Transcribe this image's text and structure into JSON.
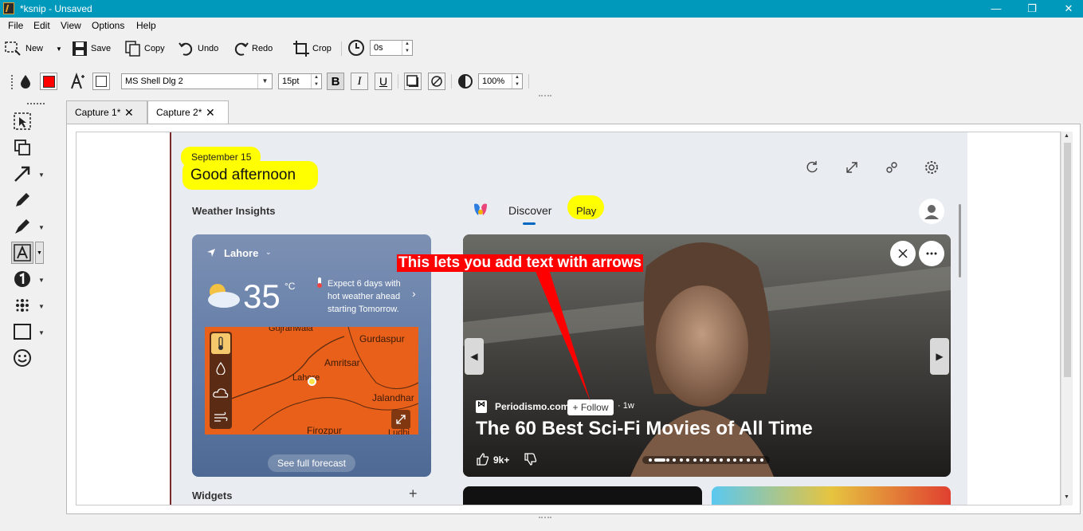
{
  "window": {
    "title": "*ksnip - Unsaved",
    "minimize": "—",
    "maximize": "❐",
    "close": "✕",
    "accent": "#0099bc"
  },
  "menu": [
    "File",
    "Edit",
    "View",
    "Options",
    "Help"
  ],
  "toolbar": {
    "new": "New",
    "save": "Save",
    "copy": "Copy",
    "undo": "Undo",
    "redo": "Redo",
    "crop": "Crop",
    "delay": "0s"
  },
  "format_bar": {
    "color": "#ff0000",
    "font": "MS Shell Dlg 2",
    "size": "15pt",
    "bold": "B",
    "italic": "I",
    "underline": "U",
    "opacity": "100%"
  },
  "tabs": [
    "Capture 1*",
    "Capture 2*"
  ],
  "tab_close": "✕",
  "widget": {
    "date": "September 15",
    "greeting": "Good afternoon",
    "weather_title": "Weather Insights",
    "tab_discover": "Discover",
    "tab_play": "Play",
    "city": "Lahore",
    "temp": "35",
    "unit": "°C",
    "forecast_note": [
      "Expect 6 days with",
      "hot weather ahead",
      "starting Tomorrow."
    ],
    "map_labels": [
      "Gujranwala",
      "Gurdaspur",
      "Amritsar",
      "Lahore",
      "Jalandhar",
      "Firozpur",
      "Ludhi"
    ],
    "see_forecast": "See full forecast",
    "widgets_label": "Widgets",
    "add": "+"
  },
  "article": {
    "source": "Periodismo.com",
    "follow": "+ Follow",
    "age": "· 1w",
    "headline": "The 60 Best Sci-Fi Movies of All Time",
    "likes": "9k+",
    "annotation": "This lets you add text with arrows"
  },
  "colors": {
    "highlight": "#ffff00",
    "annotation": "#ff0000"
  }
}
